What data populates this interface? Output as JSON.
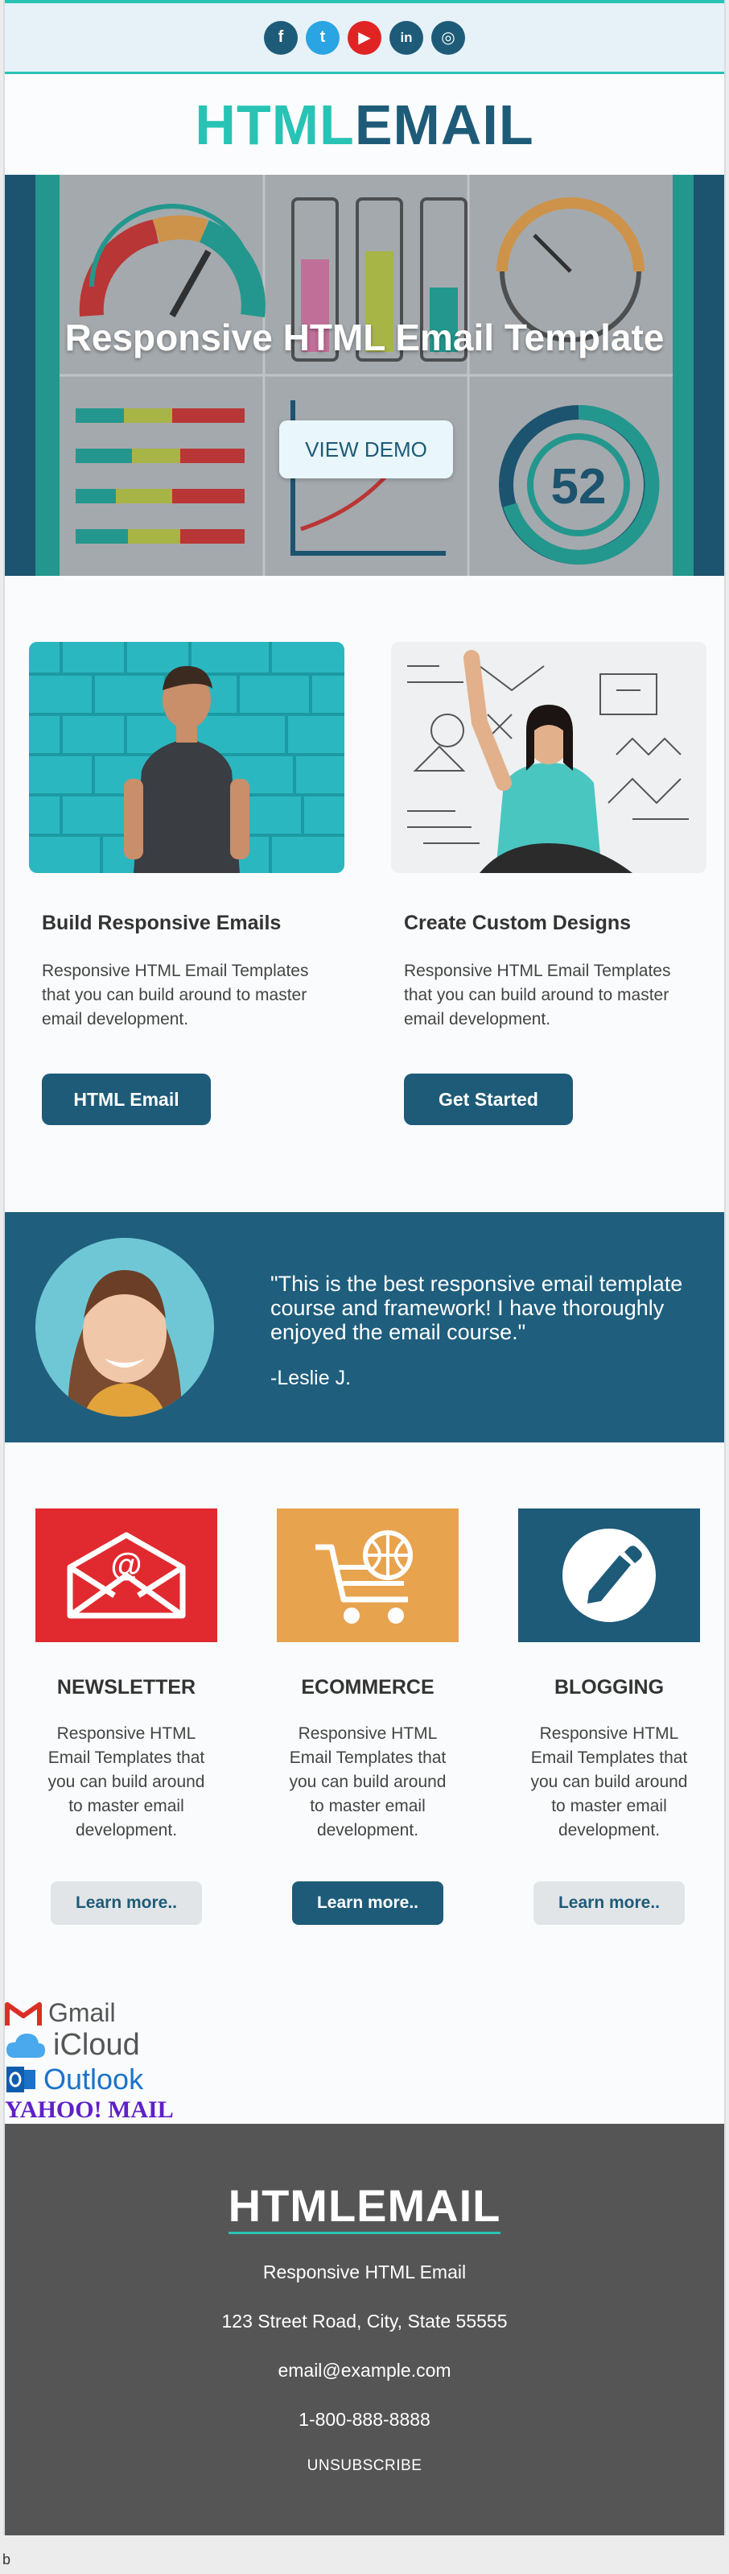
{
  "social": {
    "facebook": "f",
    "twitter": "t",
    "youtube": "▶",
    "linkedin": "in",
    "instagram": "◎"
  },
  "logo": {
    "part1": "HTML",
    "part2": "EMAIL"
  },
  "hero": {
    "title": "Responsive HTML Email Template",
    "button": "VIEW DEMO",
    "gauge_value": "52"
  },
  "cards": [
    {
      "title": "Build Responsive Emails",
      "text": "Responsive HTML Email Templates that you can build around to master email development.",
      "button": "HTML Email"
    },
    {
      "title": "Create Custom Designs",
      "text": "Responsive HTML Email Templates that you can build around to master email development.",
      "button": "Get Started"
    }
  ],
  "testimonial": {
    "quote": "\"This is the best responsive email template course and framework! I have thoroughly enjoyed the email course.\"",
    "author": "-Leslie J."
  },
  "features": [
    {
      "title": "NEWSLETTER",
      "text": "Responsive HTML Email Templates that you can build around to master email development.",
      "button": "Learn more..",
      "color": "#e02a2f"
    },
    {
      "title": "ECOMMERCE",
      "text": "Responsive HTML Email Templates that you can build around to master email development.",
      "button": "Learn more..",
      "color": "#e8a34f"
    },
    {
      "title": "BLOGGING",
      "text": "Responsive HTML Email Templates that you can build around to master email development.",
      "button": "Learn more..",
      "color": "#1e5b78"
    }
  ],
  "partners": {
    "gmail": "Gmail",
    "icloud": "iCloud",
    "outlook": "Outlook",
    "yahoo": "YAHOO! MAIL"
  },
  "footer": {
    "logo": "HTMLEMAIL",
    "company": "Responsive HTML Email",
    "address": "123 Street Road, City, State 55555",
    "email": "email@example.com",
    "phone": "1-800-888-8888",
    "unsubscribe": "UNSUBSCRIBE"
  },
  "bottom_text": "b",
  "colors": {
    "teal": "#28c3b4",
    "navy": "#1e5b78",
    "footer_bg": "#555555"
  }
}
